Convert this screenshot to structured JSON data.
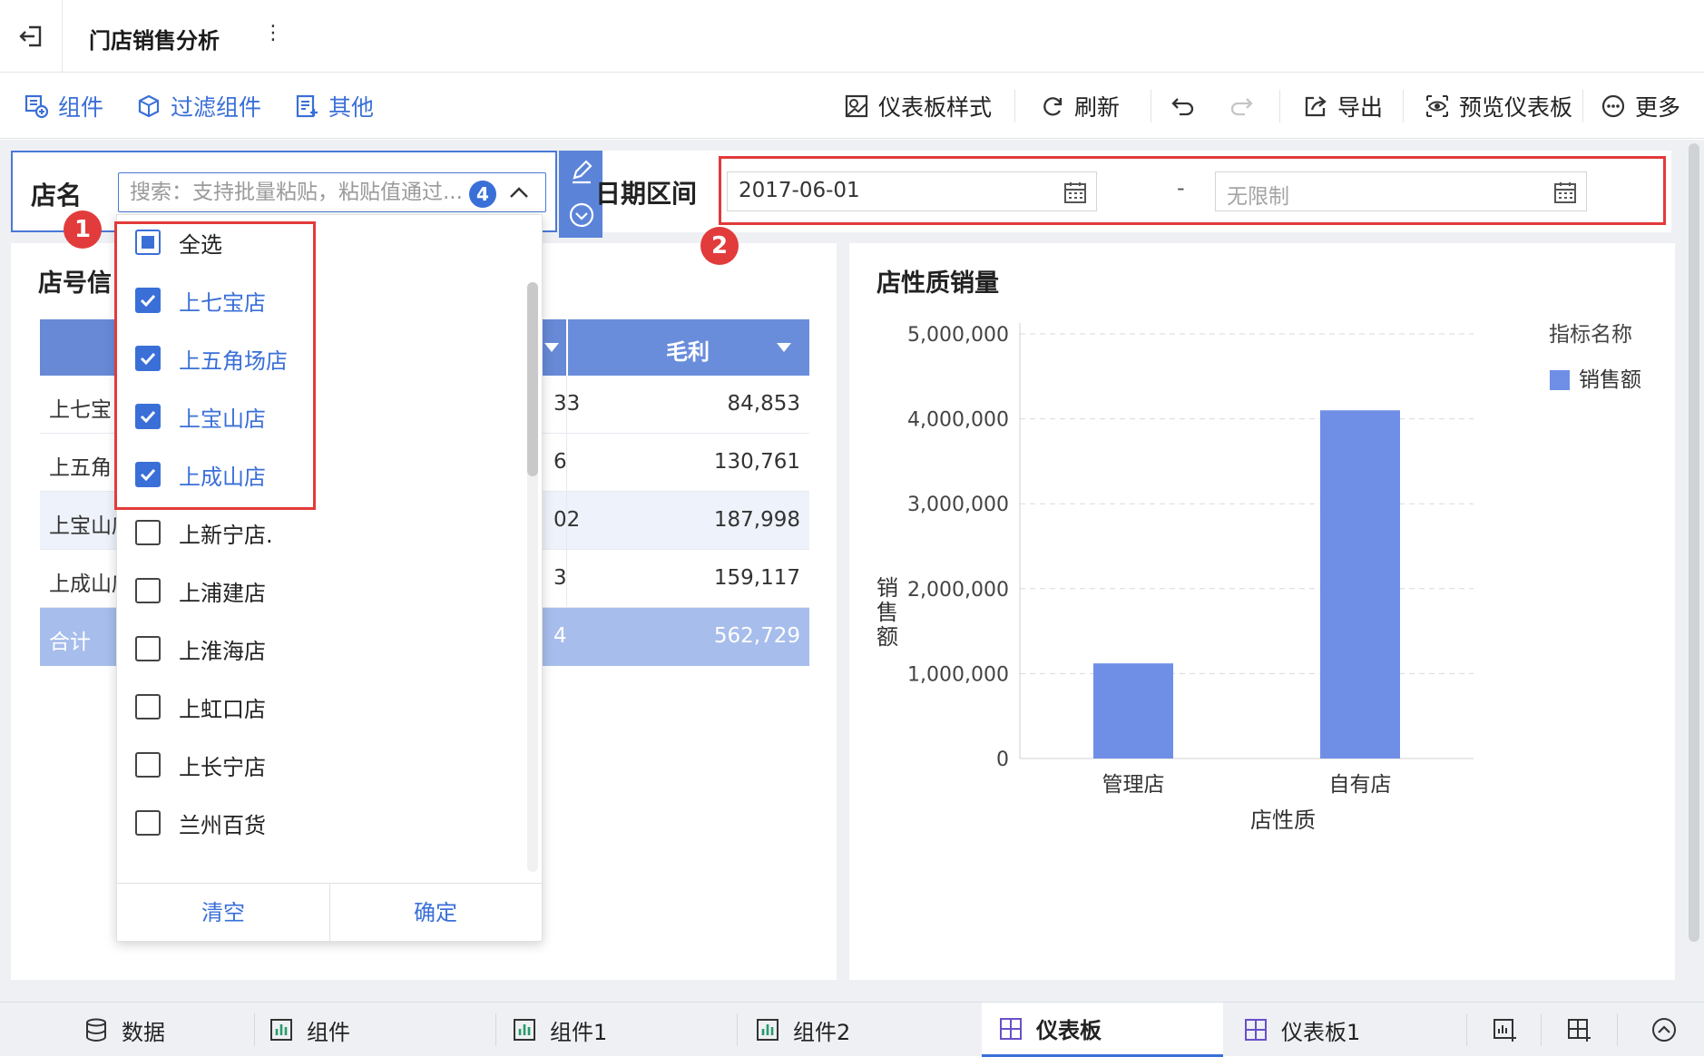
{
  "header": {
    "title": "门店销售分析",
    "more_icon": "⋮"
  },
  "toolbar": {
    "component": "组件",
    "filter_component": "过滤组件",
    "other": "其他",
    "dashboard_style": "仪表板样式",
    "refresh": "刷新",
    "export": "导出",
    "preview": "预览仪表板",
    "more": "更多"
  },
  "store_filter": {
    "label": "店名",
    "placeholder": "搜索：支持批量粘贴，粘贴值通过...",
    "selected_count": "4",
    "options": [
      {
        "label": "全选",
        "state": "partial"
      },
      {
        "label": "上七宝店",
        "state": "checked"
      },
      {
        "label": "上五角场店",
        "state": "checked"
      },
      {
        "label": "上宝山店",
        "state": "checked"
      },
      {
        "label": "上成山店",
        "state": "checked"
      },
      {
        "label": "上新宁店.",
        "state": "unchecked"
      },
      {
        "label": "上浦建店",
        "state": "unchecked"
      },
      {
        "label": "上淮海店",
        "state": "unchecked"
      },
      {
        "label": "上虹口店",
        "state": "unchecked"
      },
      {
        "label": "上长宁店",
        "state": "unchecked"
      },
      {
        "label": "兰州百货",
        "state": "unchecked"
      }
    ],
    "clear": "清空",
    "confirm": "确定"
  },
  "date_filter": {
    "label": "日期区间",
    "start": "2017-06-01",
    "end_placeholder": "无限制",
    "separator": "-"
  },
  "badges": {
    "one": "1",
    "two": "2"
  },
  "table": {
    "title": "店号信",
    "profit_header": "毛利",
    "rows": [
      {
        "name": "上七宝",
        "mid": "33",
        "profit": "84,853"
      },
      {
        "name": "上五角",
        "mid": "6",
        "profit": "130,761"
      },
      {
        "name": "上宝山店",
        "mid": "02",
        "profit": "187,998"
      },
      {
        "name": "上成山店",
        "mid": "3",
        "profit": "159,117"
      }
    ],
    "total": {
      "name": "合计",
      "mid": "4",
      "profit": "562,729"
    }
  },
  "chart_data": {
    "type": "bar",
    "title": "店性质销量",
    "categories": [
      "管理店",
      "自有店"
    ],
    "series": [
      {
        "name": "销售额",
        "values": [
          1120000,
          4100000
        ]
      }
    ],
    "xlabel": "店性质",
    "ylabel": "销售额",
    "ylim": [
      0,
      5000000
    ],
    "yticks": [
      "0",
      "1,000,000",
      "2,000,000",
      "3,000,000",
      "4,000,000",
      "5,000,000"
    ],
    "legend_title": "指标名称",
    "legend_position": "top-right",
    "grid": true,
    "color": "#6f8fe6"
  },
  "bottom_tabs": {
    "data": "数据",
    "comp": "组件",
    "comp1": "组件1",
    "comp2": "组件2",
    "dashboard": "仪表板",
    "dashboard1": "仪表板1"
  },
  "colors": {
    "accent": "#3a6fd8",
    "highlight": "#e33a3a",
    "header_blue": "#6789d6"
  }
}
